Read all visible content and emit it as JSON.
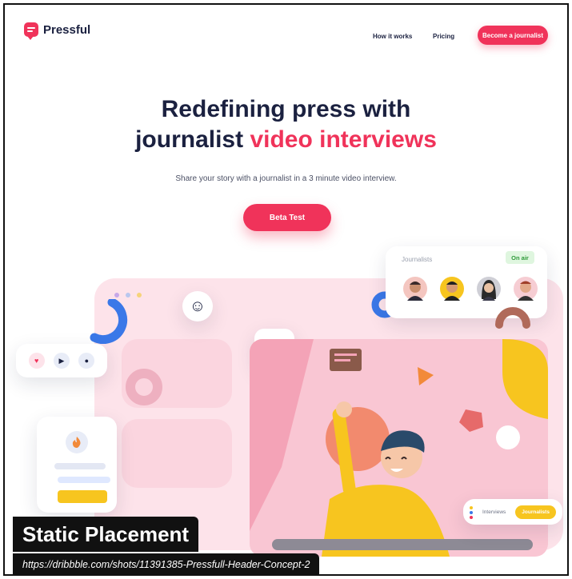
{
  "brand": {
    "name": "Pressful",
    "accent": "#f0335a",
    "navy": "#1b2140"
  },
  "nav": {
    "how_it_works": "How it works",
    "pricing": "Pricing",
    "become_journalist": "Become a journalist"
  },
  "hero": {
    "title_line1": "Redefining press with",
    "title_line2_a": "journalist",
    "title_line2_b": "video interviews",
    "subtitle": "Share your story with a journalist in a 3 minute video interview.",
    "cta": "Beta Test"
  },
  "journalists_panel": {
    "title": "Journalists",
    "status": "On air",
    "avatars": [
      "journalist-avatar-1",
      "journalist-avatar-2",
      "journalist-avatar-3",
      "journalist-avatar-4"
    ]
  },
  "controls": {
    "icons": [
      "heart-icon",
      "play-icon",
      "user-icon"
    ]
  },
  "profile_card": {
    "icon": "fire-icon"
  },
  "mode_toggle": {
    "option_1": "Interviews",
    "option_2": "Journalists",
    "selected": "Journalists"
  },
  "overlay": {
    "caption": "Static Placement",
    "url": "https://dribbble.com/shots/11391385-Pressfull-Header-Concept-2"
  }
}
